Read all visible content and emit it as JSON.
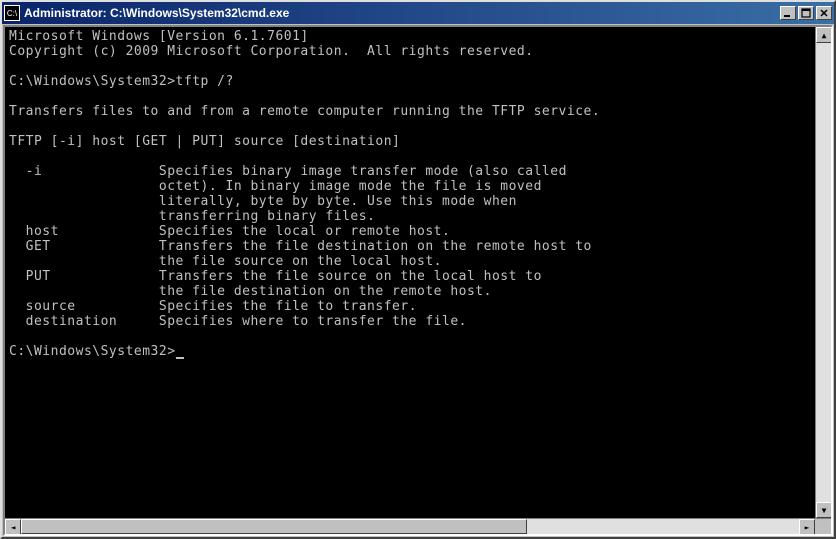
{
  "titlebar": {
    "icon_text": "C:\\",
    "title": "Administrator: C:\\Windows\\System32\\cmd.exe"
  },
  "terminal": {
    "header_line1": "Microsoft Windows [Version 6.1.7601]",
    "header_line2": "Copyright (c) 2009 Microsoft Corporation.  All rights reserved.",
    "prompt1": "C:\\Windows\\System32>",
    "command1": "tftp /?",
    "help_intro": "Transfers files to and from a remote computer running the TFTP service.",
    "usage": "TFTP [-i] host [GET | PUT] source [destination]",
    "opt_i_key": "  -i",
    "opt_i_desc1": "              Specifies binary image transfer mode (also called",
    "opt_i_desc2": "                  octet). In binary image mode the file is moved",
    "opt_i_desc3": "                  literally, byte by byte. Use this mode when",
    "opt_i_desc4": "                  transferring binary files.",
    "opt_host_key": "  host",
    "opt_host_desc": "            Specifies the local or remote host.",
    "opt_get_key": "  GET",
    "opt_get_desc1": "             Transfers the file destination on the remote host to",
    "opt_get_desc2": "                  the file source on the local host.",
    "opt_put_key": "  PUT",
    "opt_put_desc1": "             Transfers the file source on the local host to",
    "opt_put_desc2": "                  the file destination on the remote host.",
    "opt_source_key": "  source",
    "opt_source_desc": "          Specifies the file to transfer.",
    "opt_dest_key": "  destination",
    "opt_dest_desc": "     Specifies where to transfer the file.",
    "prompt2": "C:\\Windows\\System32>"
  }
}
